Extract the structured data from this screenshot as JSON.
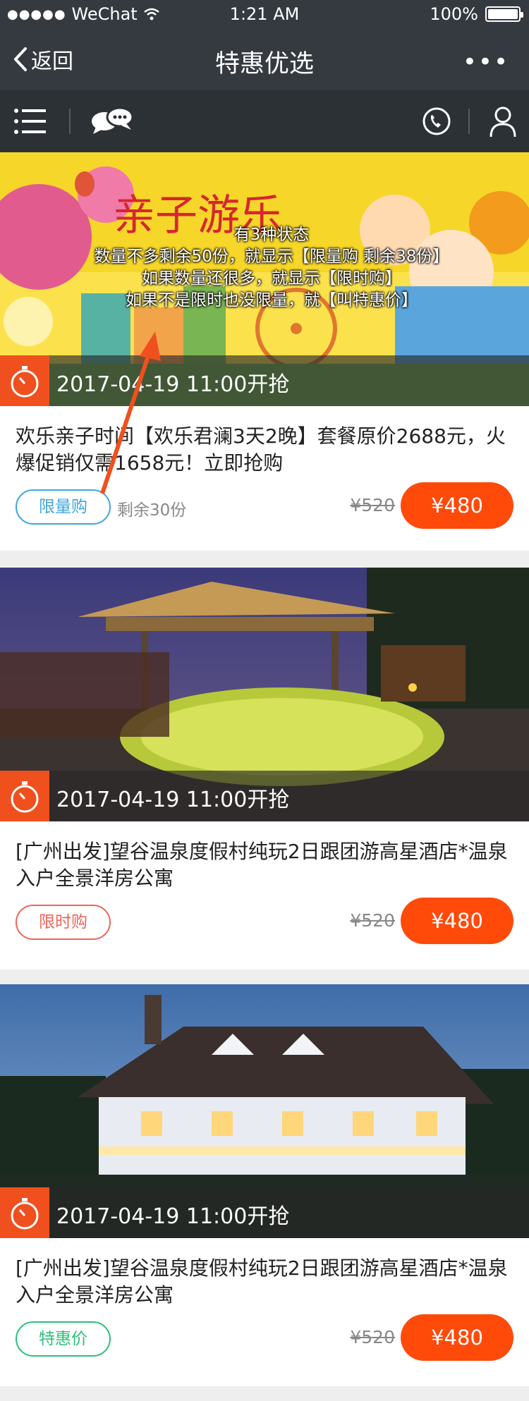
{
  "status_bar": {
    "carrier": "WeChat",
    "time": "1:21 AM",
    "battery": "100%"
  },
  "nav": {
    "back_label": "返回",
    "title": "特惠优选",
    "more": "•••"
  },
  "annotation": {
    "line1": "有3种状态",
    "line2": "数量不多剩余50份，就显示【限量购 剩余38份】",
    "line3": "如果数量还很多，就显示【限时购】",
    "line4": "如果不是限时也没限量，就【叫特惠价】"
  },
  "cards": [
    {
      "time": "2017-04-19  11:00开抢",
      "title": "欢乐亲子时间【欢乐君澜3天2晚】套餐原价2688元，火爆促销仅需1658元！立即抢购",
      "tag": "限量购",
      "tag_color": "#3ea5dc",
      "remain": "剩余30份",
      "orig_price": "¥520",
      "price": "¥480"
    },
    {
      "time": "2017-04-19  11:00开抢",
      "title": "[广州出发]望谷温泉度假村纯玩2日跟团游高星酒店*温泉入户全景洋房公寓",
      "tag": "限时购",
      "tag_color": "#f06458",
      "orig_price": "¥520",
      "price": "¥480"
    },
    {
      "time": "2017-04-19  11:00开抢",
      "title": "[广州出发]望谷温泉度假村纯玩2日跟团游高星酒店*温泉入户全景洋房公寓",
      "tag": "特惠价",
      "tag_color": "#2bbf7a",
      "orig_price": "¥520",
      "price": "¥480"
    }
  ],
  "colors": {
    "accent": "#ff4a0a",
    "navbar": "#343a40",
    "toolbar": "#2c3136"
  }
}
